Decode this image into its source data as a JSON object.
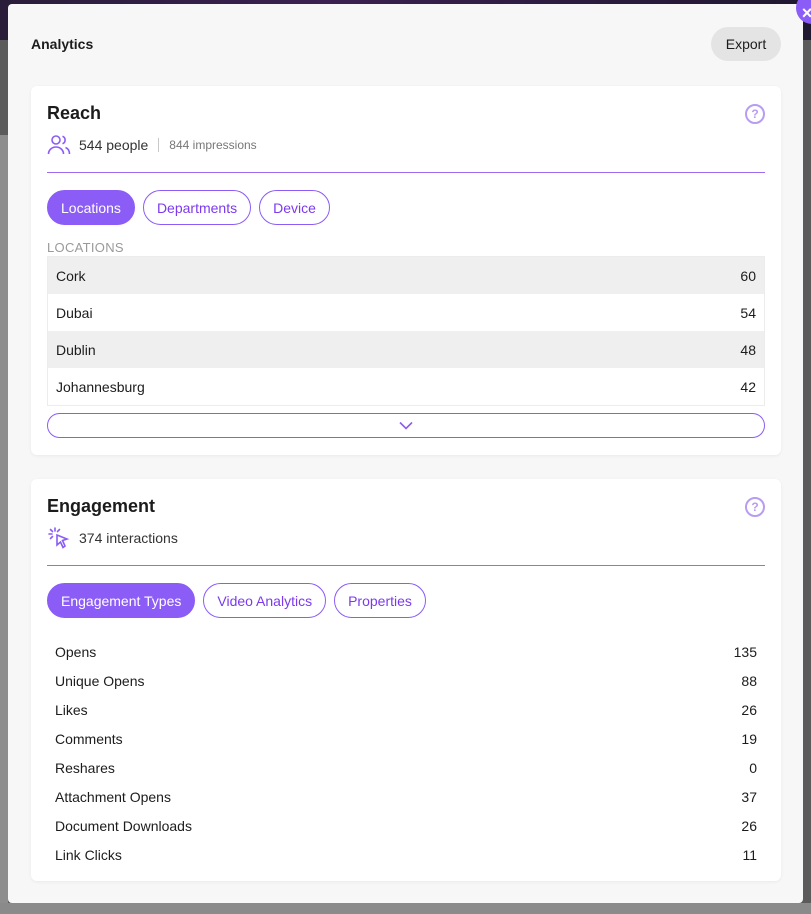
{
  "modal": {
    "title": "Analytics",
    "export_label": "Export"
  },
  "reach": {
    "title": "Reach",
    "people": "544 people",
    "impressions": "844 impressions",
    "tabs": [
      {
        "label": "Locations",
        "active": true
      },
      {
        "label": "Departments",
        "active": false
      },
      {
        "label": "Device",
        "active": false
      }
    ],
    "section_label": "LOCATIONS",
    "rows": [
      {
        "name": "Cork",
        "value": "60"
      },
      {
        "name": "Dubai",
        "value": "54"
      },
      {
        "name": "Dublin",
        "value": "48"
      },
      {
        "name": "Johannesburg",
        "value": "42"
      }
    ]
  },
  "engagement": {
    "title": "Engagement",
    "interactions": "374 interactions",
    "tabs": [
      {
        "label": "Engagement Types",
        "active": true
      },
      {
        "label": "Video Analytics",
        "active": false
      },
      {
        "label": "Properties",
        "active": false
      }
    ],
    "rows": [
      {
        "name": "Opens",
        "value": "135"
      },
      {
        "name": "Unique Opens",
        "value": "88"
      },
      {
        "name": "Likes",
        "value": "26"
      },
      {
        "name": "Comments",
        "value": "19"
      },
      {
        "name": "Reshares",
        "value": "0"
      },
      {
        "name": "Attachment Opens",
        "value": "37"
      },
      {
        "name": "Document Downloads",
        "value": "26"
      },
      {
        "name": "Link Clicks",
        "value": "11"
      }
    ]
  },
  "colors": {
    "accent": "#8b5cf6",
    "accent_light": "#b89cf2",
    "row_alt": "#efefef"
  },
  "icons": {
    "close": "close-icon",
    "help": "help-icon",
    "people": "people-icon",
    "click": "click-icon",
    "chevron": "chevron-down-icon"
  }
}
